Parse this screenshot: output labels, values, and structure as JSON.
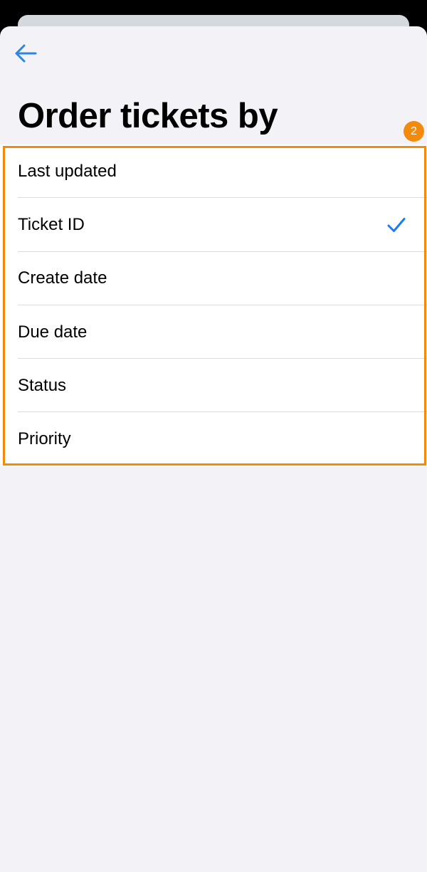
{
  "header": {
    "back_icon": "arrow-left-icon",
    "title": "Order tickets by"
  },
  "annotation": {
    "badge": "2",
    "color": "#f38a0c"
  },
  "options": [
    {
      "label": "Last updated",
      "selected": false
    },
    {
      "label": "Ticket ID",
      "selected": true
    },
    {
      "label": "Create date",
      "selected": false
    },
    {
      "label": "Due date",
      "selected": false
    },
    {
      "label": "Status",
      "selected": false
    },
    {
      "label": "Priority",
      "selected": false
    }
  ],
  "colors": {
    "accent": "#2e86de",
    "check": "#1a7cf2",
    "background": "#f2f2f7"
  }
}
